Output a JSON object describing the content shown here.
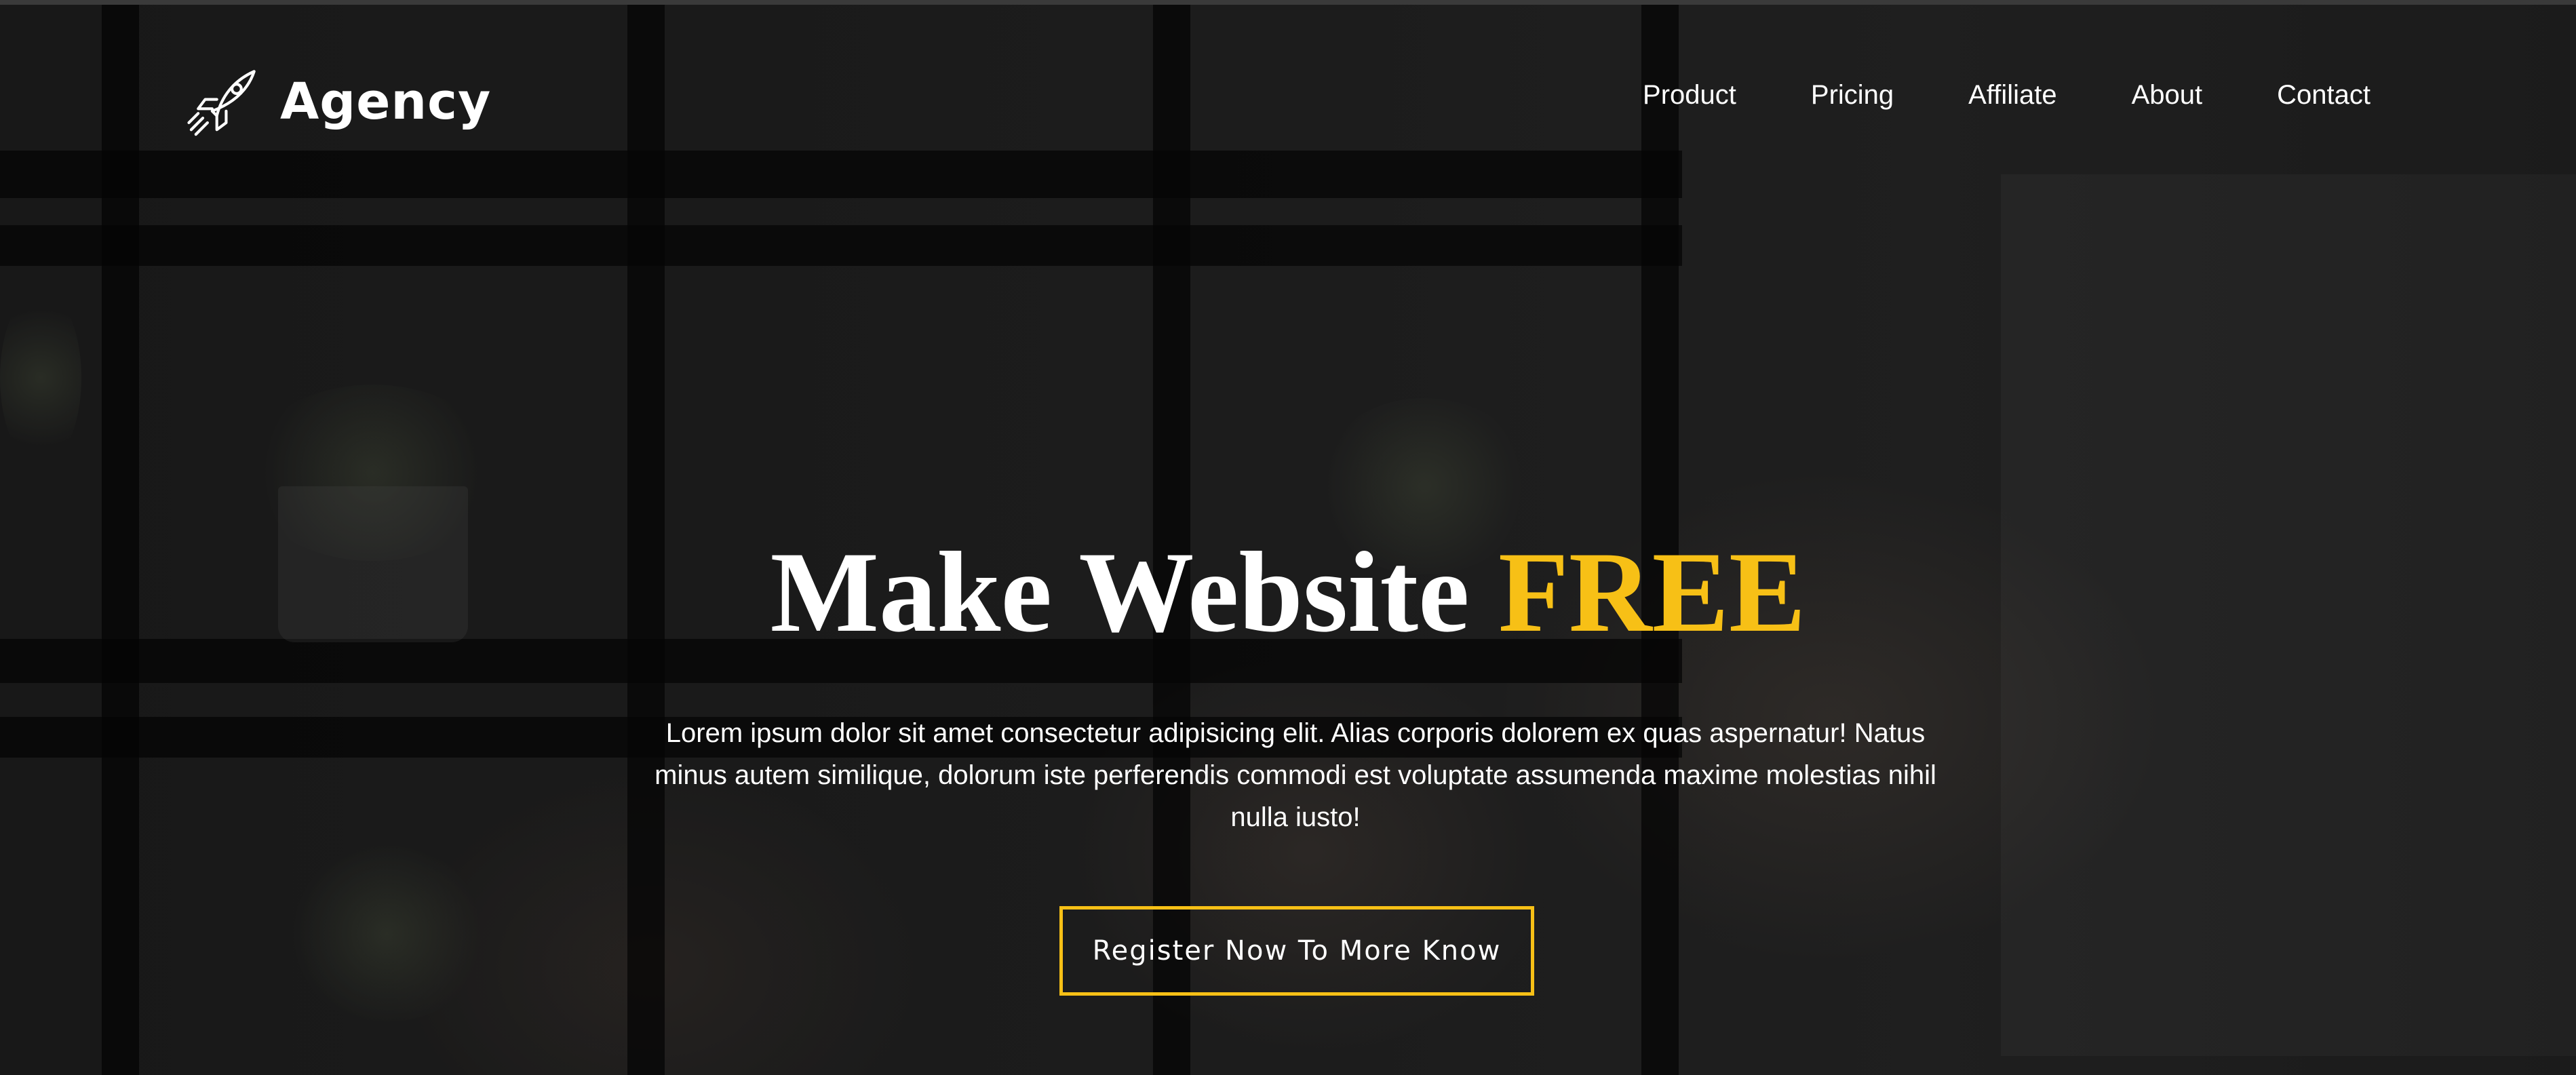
{
  "brand": {
    "name": "Agency",
    "icon": "rocket-icon"
  },
  "nav": {
    "items": [
      {
        "label": "Product"
      },
      {
        "label": "Pricing"
      },
      {
        "label": "Affiliate"
      },
      {
        "label": "About"
      },
      {
        "label": "Contact"
      }
    ]
  },
  "hero": {
    "headline_main": "Make Website",
    "headline_accent": "FREE",
    "description": "Lorem ipsum dolor sit amet consectetur adipisicing elit. Alias corporis dolorem ex quas aspernatur! Natus minus autem similique, dolorum iste perferendis commodi est voluptate assumenda maxime molestias nihil nulla iusto!",
    "cta_label": "Register Now To More Know"
  },
  "colors": {
    "accent": "#f7c016",
    "text": "#ffffff",
    "background": "#1a1a1a"
  }
}
